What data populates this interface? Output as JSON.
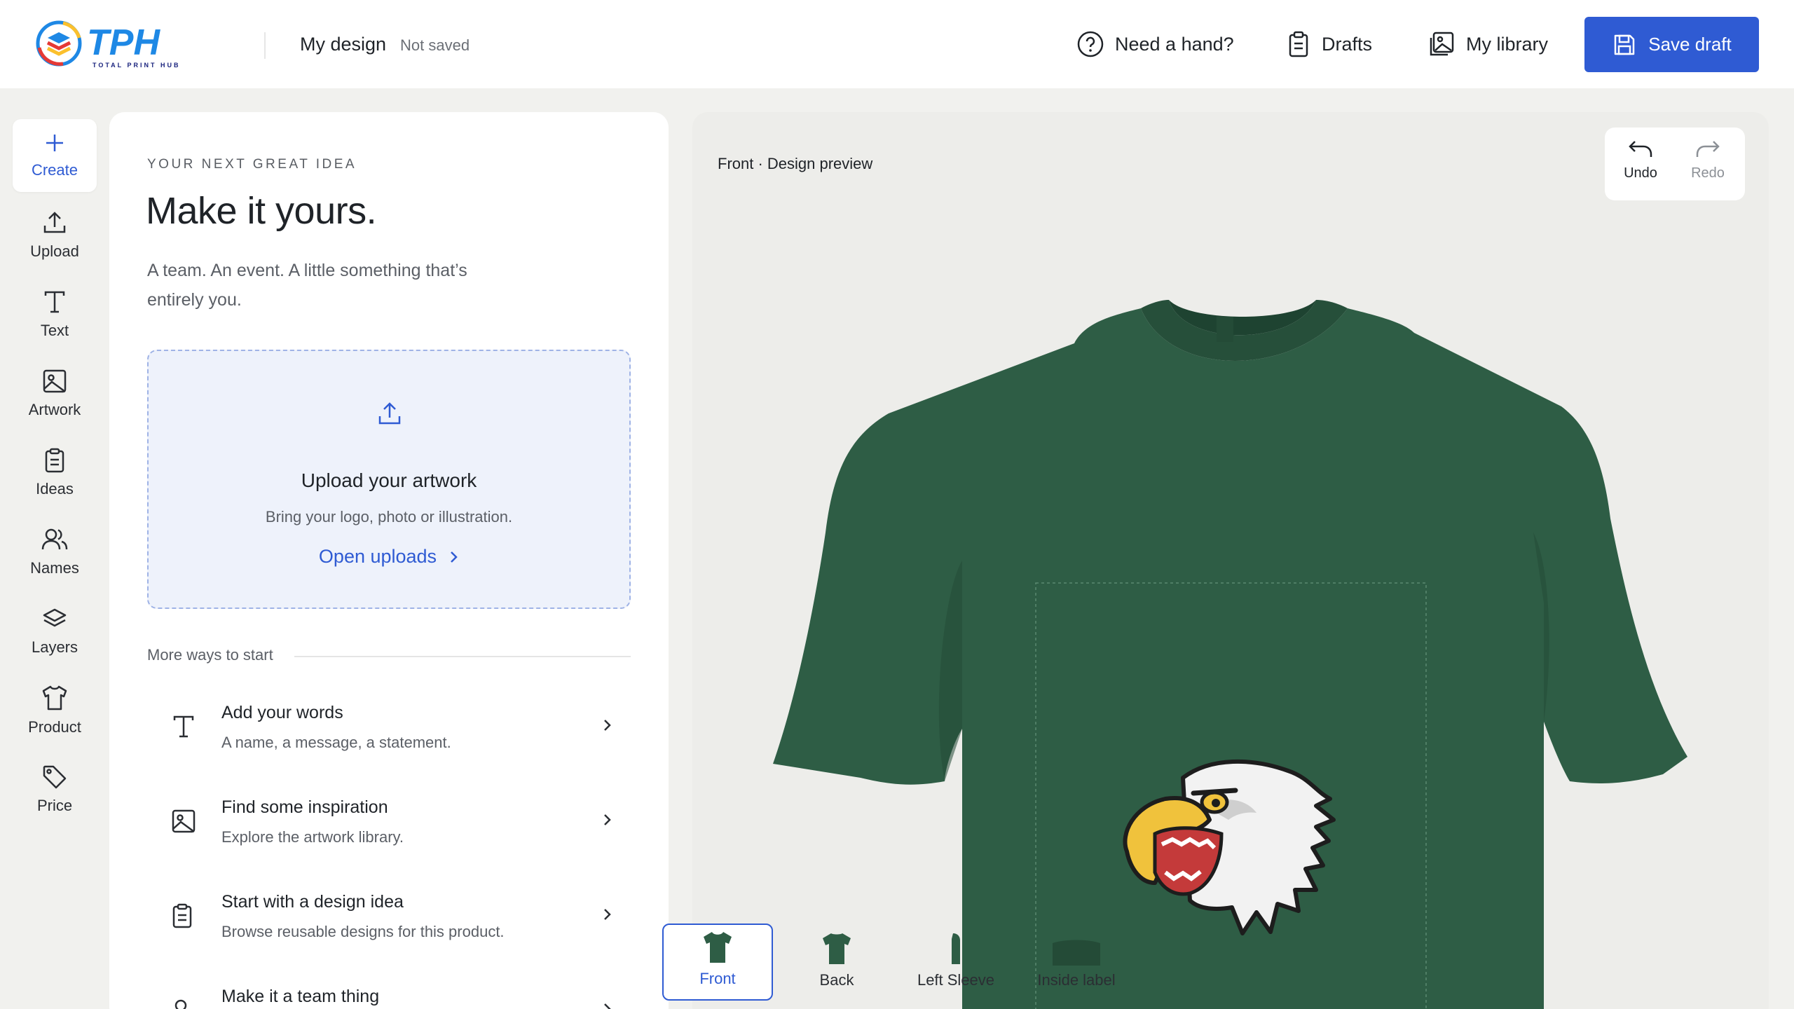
{
  "header": {
    "logo_text": "TPH",
    "logo_tagline": "TOTAL PRINT HUB",
    "doc_title": "My design",
    "doc_status": "Not saved",
    "help_label": "Need a hand?",
    "drafts_label": "Drafts",
    "library_label": "My library",
    "save_label": "Save draft"
  },
  "rail": {
    "items": [
      {
        "label": "Create",
        "icon": "plus-icon"
      },
      {
        "label": "Upload",
        "icon": "upload-icon"
      },
      {
        "label": "Text",
        "icon": "text-icon"
      },
      {
        "label": "Artwork",
        "icon": "image-icon"
      },
      {
        "label": "Ideas",
        "icon": "clipboard-icon"
      },
      {
        "label": "Names",
        "icon": "users-icon"
      },
      {
        "label": "Layers",
        "icon": "layers-icon"
      },
      {
        "label": "Product",
        "icon": "tshirt-icon"
      },
      {
        "label": "Price",
        "icon": "tag-icon"
      }
    ]
  },
  "panel": {
    "eyebrow": "YOUR NEXT GREAT IDEA",
    "headline": "Make it yours.",
    "sub": "A team. An event. A little something that’s entirely you.",
    "dropzone": {
      "title": "Upload your artwork",
      "sub": "Bring your logo, photo or illustration.",
      "link": "Open uploads"
    },
    "more_label": "More ways to start",
    "options": [
      {
        "title": "Add your words",
        "desc": "A name, a message, a statement."
      },
      {
        "title": "Find some inspiration",
        "desc": "Explore the artwork library."
      },
      {
        "title": "Start with a design idea",
        "desc": "Browse reusable designs for this product."
      },
      {
        "title": "Make it a team thing",
        "desc": ""
      }
    ]
  },
  "canvas": {
    "label": "Front · Design preview",
    "undo_label": "Undo",
    "redo_label": "Redo",
    "shirt_color": "#2e5d45",
    "views": [
      {
        "label": "Front"
      },
      {
        "label": "Back"
      },
      {
        "label": "Left Sleeve"
      },
      {
        "label": "Inside label"
      }
    ]
  },
  "colors": {
    "accent": "#2f5bd3",
    "shirt": "#2e5d45"
  }
}
